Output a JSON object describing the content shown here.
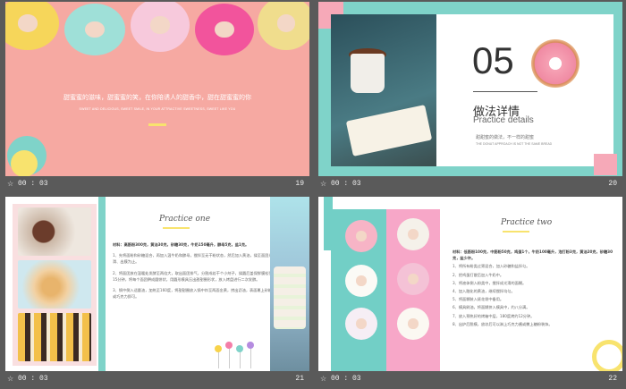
{
  "slides": [
    {
      "number": "20",
      "time": "00 : 03",
      "heading_num": "05",
      "title_cn": "做法详情",
      "title_en": "Practice details",
      "sub_cn": "甜甜蜜的做法，不一样的甜蜜",
      "sub_en": "THE DONUT APPROACH IS NOT THE SAME BREAD"
    },
    {
      "number": "19",
      "time": "00 : 03",
      "line1": "甜蜜蜜的滋味，甜蜜蜜的笑，在你陪诱人的甜香中，甜在甜蜜蜜的你",
      "line2": "SWEET AND DELICIOUS, SWEET SMILE, IN YOUR ATTRACTIVE SWEETNESS, SWEET LIKE YOU"
    },
    {
      "number": "21",
      "time": "00 : 03",
      "script_title": "Practice one",
      "paragraphs": [
        "材料：高筋粉300克，黄油30克，砂糖30克，牛奶150毫升，酵母5克，盐1克。",
        "1、先将面粉和砂糖混合，再加入温牛奶和酵母，搅拌至无干粉状态，然后加入黄油，揉至面团光滑、出膜为止。",
        "2、将面团放在温暖处发酵至两倍大，取出面团排气，分割成若干个小剂子，揉圆后盖保鲜膜松弛15分钟，将每个面团擀成圆饼状，用圆形模具压出甜甜圈形状，放入烤盘进行二次发酵。",
        "3、锅中倒入适量油，加热至160度，将甜甜圈放入锅中炸至两面金黄，捞出沥油，表面裹上砂糖或巧克力即可。"
      ]
    },
    {
      "number": "22",
      "time": "00 : 03",
      "script_title": "Practice two",
      "paragraphs": [
        "材料：低筋粉100克，中筋粉50克，鸡蛋1个，牛奶100毫升，泡打粉3克，黄油20克，砂糖30克，盐少许。",
        "1、将所有粉类过筛混合，加入砂糖和盐拌匀。",
        "2、把鸡蛋打散后加入牛奶中。",
        "3、将液体倒入粉类中，搅拌成光滑的面糊。",
        "4、加入融化的黄油，继续搅拌均匀。",
        "5、将面糊装入裱花袋中备用。",
        "6、模具刷油，将面糊挤入模具中，约八分满。",
        "7、放入预热好的烤箱中层，180度烤约12分钟。",
        "8、出炉后脱模，放凉后可以淋上巧克力酱或撒上糖粉装饰。"
      ]
    }
  ],
  "colors": {
    "pink": "#f6a9a2",
    "teal": "#7fd3c9",
    "yellow": "#f8e36e",
    "bg": "#5a5a5a"
  },
  "icons": {
    "slide_star": "star-icon"
  }
}
